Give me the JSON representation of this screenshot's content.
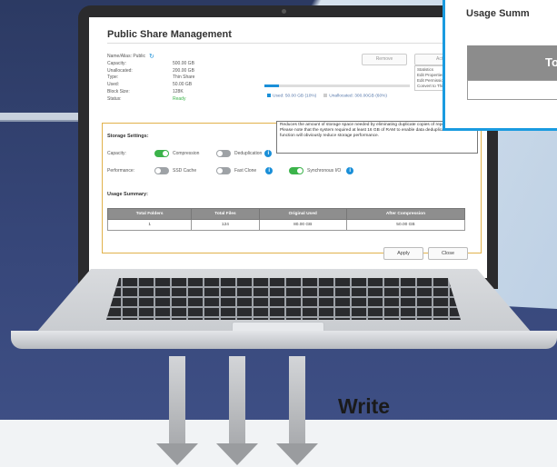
{
  "window": {
    "title": "Public Share Management",
    "name_alias_label": "Name/Alias: Public",
    "remove_label": "Remove",
    "action_label": "Action",
    "action_menu": [
      "Statistics",
      "Edit Properties",
      "Edit Permissions",
      "Convert to Thick"
    ],
    "info": [
      {
        "k": "Capacity:",
        "v": "500.00 GB"
      },
      {
        "k": "Unallocated:",
        "v": "200.00 GB"
      },
      {
        "k": "Type:",
        "v": "Thin Share"
      },
      {
        "k": "Used:",
        "v": "50.00 GB"
      },
      {
        "k": "Block Size:",
        "v": "128K"
      },
      {
        "k": "Status:",
        "v": "Ready"
      }
    ],
    "usage_bar_fraction": 0.1,
    "legend_used": "Used: 50.00 GB (10%)",
    "legend_unallocated": "Unallocated: 300.00GB (60%)",
    "storage_settings_label": "Storage Settings:",
    "description": "Reduces the amount of storage space needed by eliminating duplicate copies of repeated data. Please note that the system required at least 16 GB of RAM to enable data deduplication and this function will obviously reduce storage performance.",
    "capacity_label": "Capacity:",
    "performance_label": "Performance:",
    "compression_label": "Compression",
    "deduplication_label": "Deduplication",
    "ssd_cache_label": "SSD Cache",
    "fast_clone_label": "Fast Clone",
    "synchronous_io_label": "Synchronous I/O",
    "usage_summary_label": "Usage Summary:",
    "table": {
      "headers": [
        "Total Folders",
        "Total Files",
        "Original Used",
        "After Compression"
      ],
      "row": [
        "1",
        "124",
        "80.00 GB",
        "50.00 GB"
      ]
    },
    "apply_label": "Apply",
    "close_label": "Close"
  },
  "zoom": {
    "title": "Usage Summ",
    "header": "To"
  },
  "caption": "Write",
  "colors": {
    "accent": "#1a9be0",
    "toggle_on": "#3bb34a",
    "highlight_border": "#e1b24b",
    "background": "#2c3a63"
  }
}
